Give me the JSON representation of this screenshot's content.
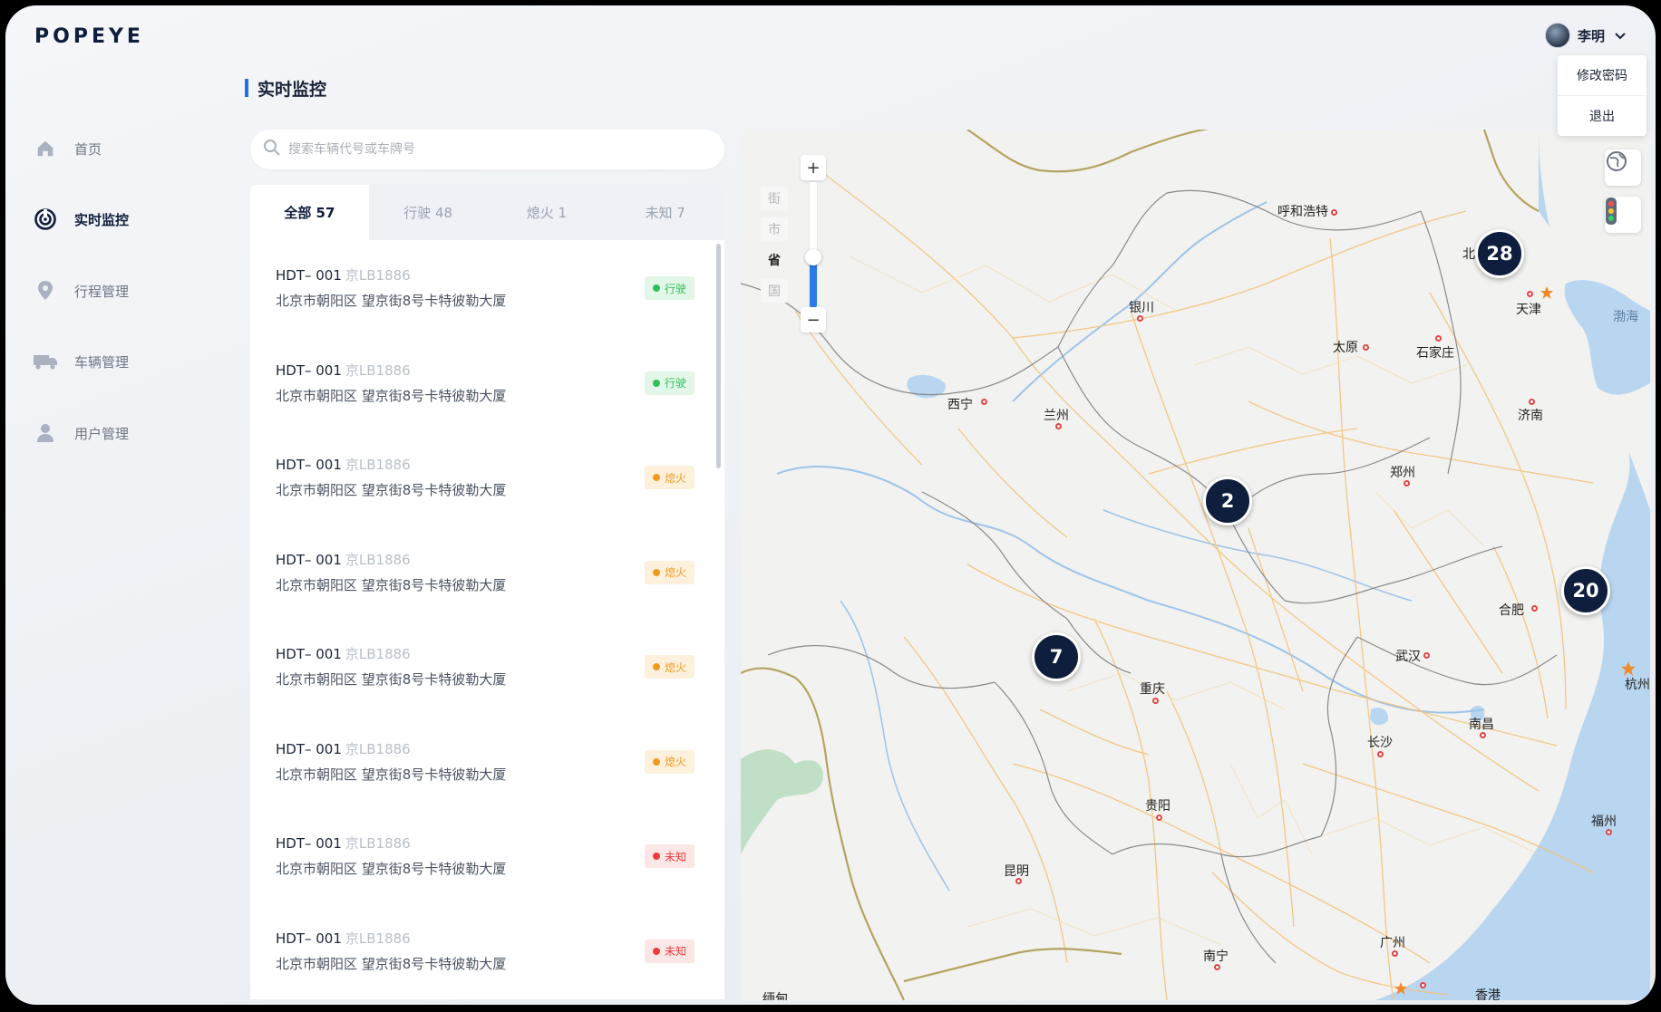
{
  "app": {
    "logo": "POPEYE"
  },
  "user": {
    "name": "李明",
    "menu": [
      "修改密码",
      "退出"
    ]
  },
  "sidebar": {
    "items": [
      {
        "label": "首页",
        "icon": "home-icon",
        "active": false
      },
      {
        "label": "实时监控",
        "icon": "radar-icon",
        "active": true
      },
      {
        "label": "行程管理",
        "icon": "location-pin-icon",
        "active": false
      },
      {
        "label": "车辆管理",
        "icon": "truck-icon",
        "active": false
      },
      {
        "label": "用户管理",
        "icon": "user-icon",
        "active": false
      }
    ]
  },
  "page": {
    "title": "实时监控"
  },
  "search": {
    "placeholder": "搜索车辆代号或车牌号",
    "value": ""
  },
  "tabs": [
    {
      "label": "全部 57",
      "active": true
    },
    {
      "label": "行驶 48",
      "active": false
    },
    {
      "label": "熄火 1",
      "active": false
    },
    {
      "label": "未知 7",
      "active": false
    }
  ],
  "vehicles": [
    {
      "code": "HDT– 001",
      "plate": "京LB1886",
      "address": "北京市朝阳区 望京街8号卡特彼勒大厦",
      "status": "行驶"
    },
    {
      "code": "HDT– 001",
      "plate": "京LB1886",
      "address": "北京市朝阳区 望京街8号卡特彼勒大厦",
      "status": "行驶"
    },
    {
      "code": "HDT– 001",
      "plate": "京LB1886",
      "address": "北京市朝阳区 望京街8号卡特彼勒大厦",
      "status": "熄火"
    },
    {
      "code": "HDT– 001",
      "plate": "京LB1886",
      "address": "北京市朝阳区 望京街8号卡特彼勒大厦",
      "status": "熄火"
    },
    {
      "code": "HDT– 001",
      "plate": "京LB1886",
      "address": "北京市朝阳区 望京街8号卡特彼勒大厦",
      "status": "熄火"
    },
    {
      "code": "HDT– 001",
      "plate": "京LB1886",
      "address": "北京市朝阳区 望京街8号卡特彼勒大厦",
      "status": "熄火"
    },
    {
      "code": "HDT– 001",
      "plate": "京LB1886",
      "address": "北京市朝阳区 望京街8号卡特彼勒大厦",
      "status": "未知"
    },
    {
      "code": "HDT– 001",
      "plate": "京LB1886",
      "address": "北京市朝阳区 望京街8号卡特彼勒大厦",
      "status": "未知"
    }
  ],
  "status_colors": {
    "行驶": {
      "fg": "#2fbf5a",
      "bg": "#e3f7e8"
    },
    "熄火": {
      "fg": "#f29a1f",
      "bg": "#fdf1dd"
    },
    "未知": {
      "fg": "#ee3b3b",
      "bg": "#fde6e6"
    }
  },
  "map": {
    "zoom_levels": [
      "街",
      "市",
      "省",
      "国"
    ],
    "zoom_selected": "省",
    "zoom_in_label": "+",
    "zoom_out_label": "−",
    "tools": [
      "map-style-icon",
      "traffic-light-icon"
    ],
    "clusters": [
      {
        "count": "28"
      },
      {
        "count": "2"
      },
      {
        "count": "20"
      },
      {
        "count": "7"
      }
    ],
    "cities": [
      "呼和浩特",
      "北",
      "天津",
      "渤海",
      "银川",
      "太原",
      "石家庄",
      "西宁",
      "兰州",
      "济南",
      "郑州",
      "合肥",
      "杭州",
      "武汉",
      "重庆",
      "长沙",
      "南昌",
      "贵阳",
      "福州",
      "昆明",
      "广州",
      "南宁",
      "香港",
      "缅甸"
    ]
  },
  "colors": {
    "accent": "#1f6fe5",
    "navy": "#0f1e3c"
  }
}
